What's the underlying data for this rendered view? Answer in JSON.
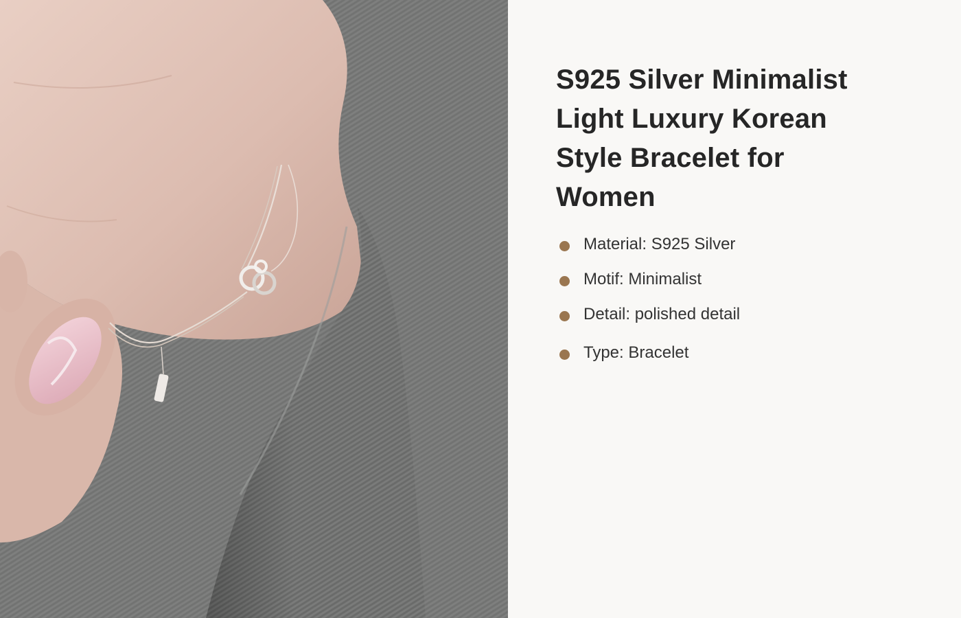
{
  "product": {
    "title": "S925 Silver Minimalist Light Luxury Korean Style Bracelet for Women",
    "image_alt_icon": "product-photo-bracelet",
    "accent_color": "#9a7650"
  },
  "features": [
    {
      "label": "Material: S925 Silver"
    },
    {
      "label": "Motif: Minimalist"
    },
    {
      "label": "Detail: polished detail"
    },
    {
      "label": "Type: Bracelet"
    }
  ]
}
